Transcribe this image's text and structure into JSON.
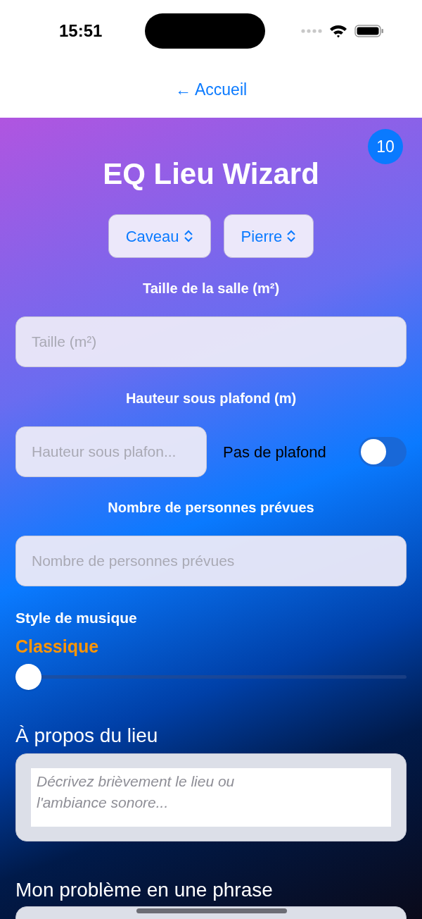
{
  "status_bar": {
    "time": "15:51"
  },
  "nav": {
    "back_label": "← Accueil"
  },
  "badge": "10",
  "title": "EQ Lieu Wizard",
  "pickers": [
    {
      "label": "Caveau"
    },
    {
      "label": "Pierre"
    }
  ],
  "size": {
    "label": "Taille de la salle (m²)",
    "placeholder": "Taille (m²)"
  },
  "height": {
    "label": "Hauteur sous plafond (m)",
    "placeholder": "Hauteur sous plafon...",
    "no_ceiling": {
      "label": "Pas de plafond",
      "on": false
    }
  },
  "people": {
    "label": "Nombre de personnes prévues",
    "placeholder": "Nombre de personnes prévues"
  },
  "music": {
    "label": "Style de musique",
    "value": "Classique",
    "level": 0
  },
  "about": {
    "label": "À propos du lieu",
    "placeholder": "Décrivez brièvement le lieu ou l'ambiance sonore..."
  },
  "problem": {
    "label": "Mon problème en une phrase"
  }
}
